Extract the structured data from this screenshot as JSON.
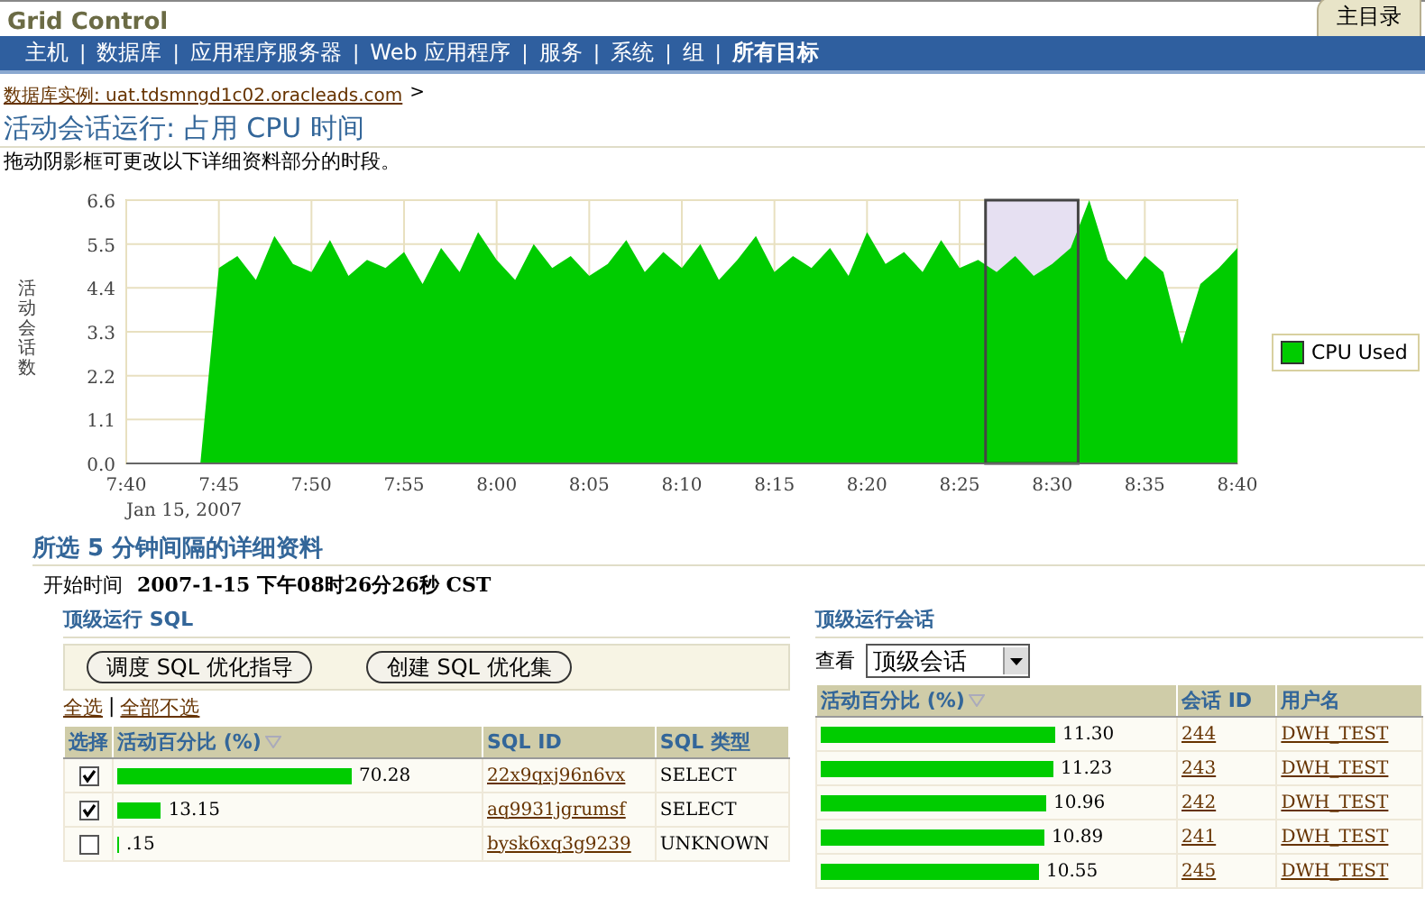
{
  "header": {
    "product": "Grid Control",
    "home_tab": "主目录"
  },
  "nav_separator": "|",
  "nav": [
    {
      "label": "主机",
      "selected": false
    },
    {
      "label": "数据库",
      "selected": false
    },
    {
      "label": "应用程序服务器",
      "selected": false
    },
    {
      "label": "Web 应用程序",
      "selected": false
    },
    {
      "label": "服务",
      "selected": false
    },
    {
      "label": "系统",
      "selected": false
    },
    {
      "label": "组",
      "selected": false
    },
    {
      "label": "所有目标",
      "selected": true
    }
  ],
  "breadcrumb": {
    "link": "数据库实例: uat.tdsmngd1c02.oracleads.com",
    "separator": ">"
  },
  "page_title": "活动会话运行: 占用  CPU 时间",
  "instruction": "拖动阴影框可更改以下详细资料部分的时段。",
  "chart": {
    "chart_data": {
      "type": "area",
      "ylabel": "活动会话数",
      "xlabel": "Jan 15, 2007",
      "categories": [
        "7:40",
        null,
        null,
        null,
        null,
        "7:45",
        null,
        null,
        null,
        null,
        "7:50",
        null,
        null,
        null,
        null,
        "7:55",
        null,
        null,
        null,
        null,
        "8:00",
        null,
        null,
        null,
        null,
        "8:05",
        null,
        null,
        null,
        null,
        "8:10",
        null,
        null,
        null,
        null,
        "8:15",
        null,
        null,
        null,
        null,
        "8:20",
        null,
        null,
        null,
        null,
        "8:25",
        null,
        null,
        null,
        null,
        "8:30",
        null,
        null,
        null,
        null,
        "8:35",
        null,
        null,
        null,
        null,
        "8:40"
      ],
      "series": [
        {
          "name": "CPU Used",
          "color": "#00cc00",
          "values": [
            0,
            0,
            0,
            0,
            0,
            4.9,
            5.2,
            4.6,
            5.7,
            5.0,
            4.8,
            5.6,
            4.7,
            5.1,
            4.9,
            5.3,
            4.5,
            5.4,
            4.8,
            5.8,
            5.1,
            4.6,
            5.5,
            4.9,
            5.2,
            4.7,
            5.0,
            5.6,
            4.8,
            5.3,
            4.9,
            5.5,
            4.6,
            5.1,
            5.7,
            4.8,
            5.2,
            4.9,
            5.4,
            4.7,
            5.8,
            5.0,
            5.3,
            4.8,
            5.6,
            4.9,
            5.1,
            4.8,
            5.2,
            4.7,
            5.0,
            5.4,
            6.6,
            5.1,
            4.6,
            5.2,
            4.8,
            3.0,
            4.5,
            4.9,
            5.4
          ]
        }
      ],
      "ylim": [
        0,
        6.6
      ],
      "yticks": [
        {
          "value": 0,
          "label": "0.0"
        },
        {
          "value": 1.1,
          "label": "1.1"
        },
        {
          "value": 2.2,
          "label": "2.2"
        },
        {
          "value": 3.3,
          "label": "3.3"
        },
        {
          "value": 4.4,
          "label": "4.4"
        },
        {
          "value": 5.5,
          "label": "5.5"
        },
        {
          "value": 6.6,
          "label": "6.6"
        }
      ],
      "grid": true
    }
  },
  "detail": {
    "title": "所选  5 分钟间隔的详细资料",
    "start_label": "开始时间",
    "start_value": "2007-1-15 下午08时26分26秒   CST"
  },
  "top_sql": {
    "title": "顶级运行  SQL",
    "buttons": [
      "调度 SQL 优化指导",
      "创建 SQL 优化集"
    ],
    "select_all": "全选",
    "link_separator": "|",
    "select_none": "全部不选",
    "columns": [
      "选择",
      "活动百分比  (%)",
      "SQL ID",
      "SQL 类型"
    ],
    "rows": [
      {
        "checked": true,
        "level": 0.7028,
        "value": "70.28",
        "sql_id": "22x9qxj96n6vx",
        "type": "SELECT"
      },
      {
        "checked": true,
        "level": 0.1315,
        "value": "13.15",
        "sql_id": "aq9931jgrumsf",
        "type": "SELECT"
      },
      {
        "checked": false,
        "level": 0.0015,
        "value": ".15",
        "sql_id": "bysk6xq3g9239",
        "type": "UNKNOWN"
      }
    ]
  },
  "top_sessions": {
    "title": "顶级运行会话",
    "view_label": "查看",
    "view_value": "顶级会话",
    "columns": [
      "活动百分比  (%)",
      "会话  ID",
      "用户名"
    ],
    "rows": [
      {
        "level": 0.65,
        "value": "11.30",
        "session_id": "244",
        "user": "DWH_TEST"
      },
      {
        "level": 0.645,
        "value": "11.23",
        "session_id": "243",
        "user": "DWH_TEST"
      },
      {
        "level": 0.625,
        "value": "10.96",
        "session_id": "242",
        "user": "DWH_TEST"
      },
      {
        "level": 0.62,
        "value": "10.89",
        "session_id": "241",
        "user": "DWH_TEST"
      },
      {
        "level": 0.605,
        "value": "10.55",
        "session_id": "245",
        "user": "DWH_TEST"
      }
    ]
  }
}
